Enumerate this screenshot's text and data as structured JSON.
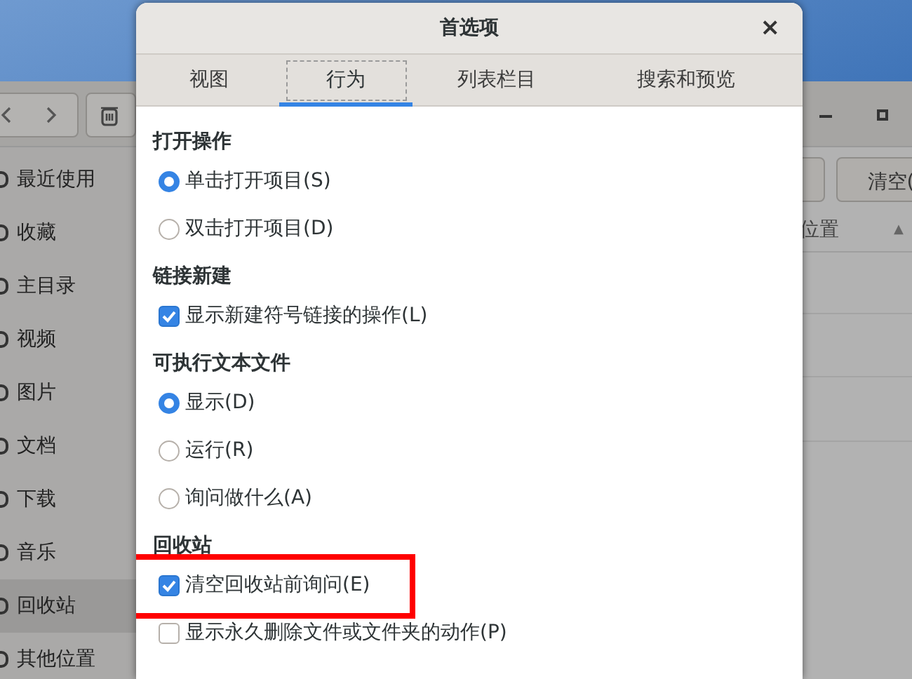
{
  "background_window": {
    "toolbar_buttons": [
      {
        "label": "清空("
      }
    ],
    "column_header": {
      "label": "位置",
      "sort": "▲"
    },
    "sidebar": [
      {
        "label": "最近使用",
        "selected": false
      },
      {
        "label": "收藏",
        "selected": false
      },
      {
        "label": "主目录",
        "selected": false
      },
      {
        "label": "视频",
        "selected": false
      },
      {
        "label": "图片",
        "selected": false
      },
      {
        "label": "文档",
        "selected": false
      },
      {
        "label": "下载",
        "selected": false
      },
      {
        "label": "音乐",
        "selected": false
      },
      {
        "label": "回收站",
        "selected": true
      },
      {
        "label": "其他位置",
        "selected": false
      }
    ]
  },
  "dialog": {
    "title": "首选项",
    "close": "×",
    "tabs": [
      {
        "label": "视图",
        "selected": false
      },
      {
        "label": "行为",
        "selected": true
      },
      {
        "label": "列表栏目",
        "selected": false
      },
      {
        "label": "搜索和预览",
        "selected": false
      }
    ],
    "sections": [
      {
        "heading": "打开操作",
        "options": [
          {
            "kind": "radio",
            "label": "单击打开项目(S)",
            "checked": true,
            "highlighted": false
          },
          {
            "kind": "radio",
            "label": "双击打开项目(D)",
            "checked": false,
            "highlighted": false
          }
        ]
      },
      {
        "heading": "链接新建",
        "options": [
          {
            "kind": "checkbox",
            "label": "显示新建符号链接的操作(L)",
            "checked": true,
            "highlighted": false
          }
        ]
      },
      {
        "heading": "可执行文本文件",
        "options": [
          {
            "kind": "radio",
            "label": "显示(D)",
            "checked": true,
            "highlighted": false
          },
          {
            "kind": "radio",
            "label": "运行(R)",
            "checked": false,
            "highlighted": false
          },
          {
            "kind": "radio",
            "label": "询问做什么(A)",
            "checked": false,
            "highlighted": false
          }
        ]
      },
      {
        "heading": "回收站",
        "options": [
          {
            "kind": "checkbox",
            "label": "清空回收站前询问(E)",
            "checked": true,
            "highlighted": true
          },
          {
            "kind": "checkbox",
            "label": "显示永久删除文件或文件夹的动作(P)",
            "checked": false,
            "highlighted": false
          }
        ]
      }
    ]
  }
}
